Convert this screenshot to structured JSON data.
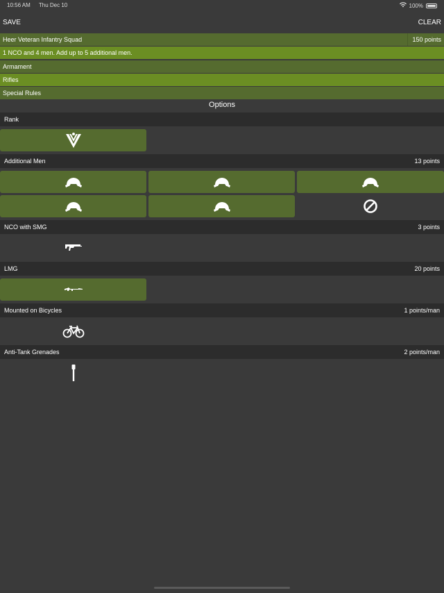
{
  "status": {
    "time": "10:56 AM",
    "date": "Thu Dec 10",
    "battery": "100%"
  },
  "nav": {
    "save": "SAVE",
    "clear": "CLEAR"
  },
  "unit": {
    "name": "Heer Veteran Infantry Squad",
    "points": "150 points",
    "description": "1 NCO and 4 men. Add up to 5 additional men.",
    "armament_label": "Armament",
    "weapon": "Rifles",
    "special_rules_label": "Special Rules"
  },
  "options_title": "Options",
  "sections": {
    "rank": {
      "label": "Rank",
      "points": ""
    },
    "additional_men": {
      "label": "Additional Men",
      "points": "13 points"
    },
    "nco_smg": {
      "label": "NCO with SMG",
      "points": "3 points"
    },
    "lmg": {
      "label": "LMG",
      "points": "20 points"
    },
    "bicycles": {
      "label": "Mounted on Bicycles",
      "points": "1 points/man"
    },
    "at_grenades": {
      "label": "Anti-Tank Grenades",
      "points": "2 points/man"
    }
  },
  "icons": {
    "rank": "rank-chevron-icon",
    "men": "helmet-icon",
    "none": "no-entry-icon",
    "smg": "smg-icon",
    "lmg": "lmg-icon",
    "bicycle": "bicycle-icon",
    "grenade": "stick-grenade-icon"
  },
  "colors": {
    "background": "#3a3a3a",
    "selected": "#556b2f",
    "highlight": "#6b8e23",
    "section_header": "#2c2c2c"
  }
}
